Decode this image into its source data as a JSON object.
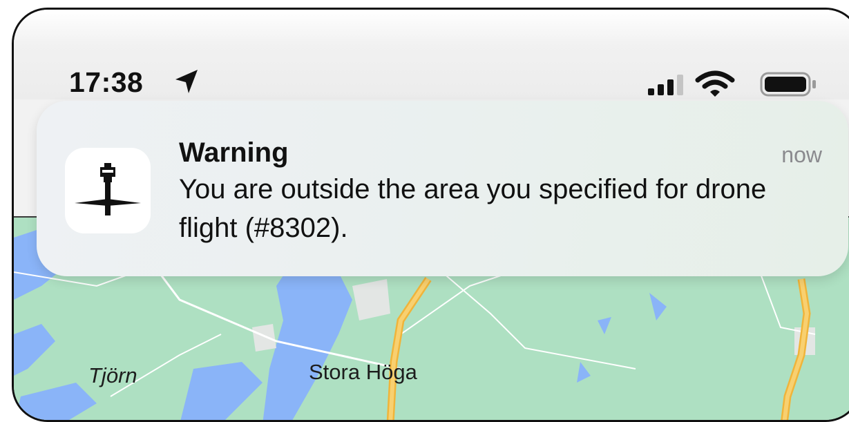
{
  "status_bar": {
    "time": "17:38",
    "location_icon": "location-arrow-icon",
    "signal_icon": "cellular-signal-icon",
    "wifi_icon": "wifi-icon",
    "battery_icon": "battery-icon"
  },
  "notification": {
    "app_icon": "control-tower-icon",
    "title": "Warning",
    "time": "now",
    "body": "You are outside the area you specified for drone flight (#8302)."
  },
  "map": {
    "labels": {
      "tjorn": "Tjörn",
      "stora_hoga": "Stora Höga"
    },
    "colors": {
      "land": "#aee0c2",
      "water": "#8ab4f8",
      "highway": "#f5c34c",
      "urban": "#e3e6e4"
    }
  }
}
